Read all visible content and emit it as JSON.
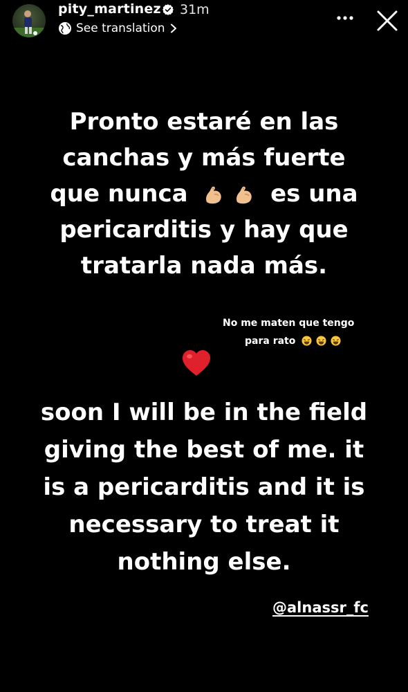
{
  "header": {
    "username": "pity_martinez",
    "time": "31m",
    "see_translation": "See translation"
  },
  "story": {
    "spanish_lines": [
      "Pronto estaré en las",
      "canchas y más fuerte",
      "que nunca",
      "es una",
      "pericarditis y hay que",
      "tratarla nada más."
    ],
    "note": {
      "line1": "No me maten que tengo",
      "line2": "para rato"
    },
    "english_lines": [
      "soon I will be in the field",
      "giving the best of me.  it",
      "is a pericarditis and it is",
      "necessary to treat it",
      "nothing else."
    ],
    "mention": "@alnassr_fc"
  },
  "colors": {
    "background": "#000000",
    "text": "#ffffff",
    "verified": "#ffffff",
    "heart": "#e0202a",
    "flex_emoji": "#f0c08e"
  },
  "icons": [
    "avatar",
    "verified-icon",
    "globe-icon",
    "chevron-right-icon",
    "more-icon",
    "close-icon",
    "flexed-biceps-icon",
    "laughing-emoji-icon",
    "red-heart-icon"
  ]
}
